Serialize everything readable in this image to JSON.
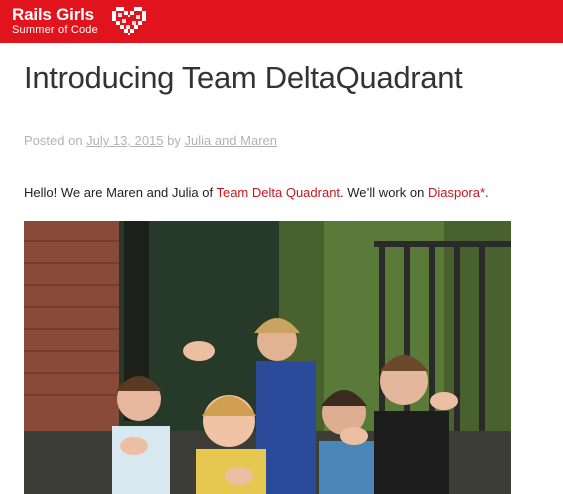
{
  "header": {
    "brand_title": "Rails Girls",
    "brand_subtitle": "Summer of Code",
    "accent_color": "#e1141d",
    "logo_icon": "pixel-heart-icon"
  },
  "post": {
    "title": "Introducing Team DeltaQuadrant",
    "meta_prefix": "Posted on",
    "date": "July 13, 2015",
    "by_text": "by",
    "author": "Julia and Maren",
    "intro_before": "Hello! We are Maren and Julia of ",
    "team_link": "Team Delta Quadrant",
    "intro_middle": ". We’ll work on ",
    "project_link": "Diaspora*",
    "intro_after": ".",
    "link_color": "#c8161d"
  }
}
